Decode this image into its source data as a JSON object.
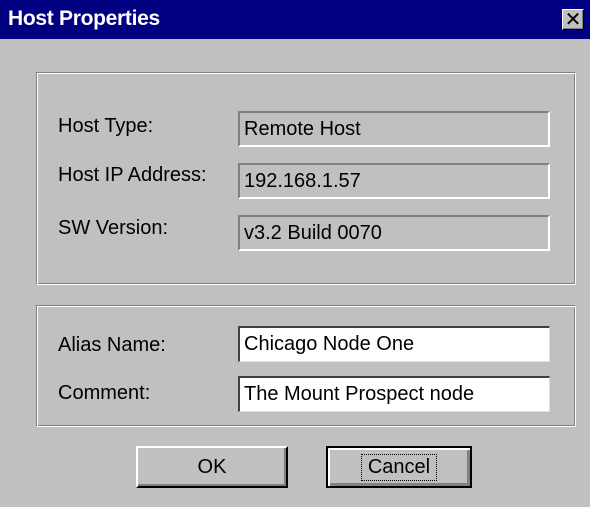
{
  "window": {
    "title": "Host Properties",
    "close_glyph": "✕"
  },
  "info": {
    "host_type_label": "Host Type:",
    "host_type_value": "Remote  Host",
    "host_ip_label": "Host IP Address:",
    "host_ip_value": "192.168.1.57",
    "sw_version_label": "SW Version:",
    "sw_version_value": "v3.2  Build 0070"
  },
  "edit": {
    "alias_label": "Alias Name:",
    "alias_value": "Chicago Node One",
    "comment_label": "Comment:",
    "comment_value": "The Mount Prospect node"
  },
  "buttons": {
    "ok_label": "OK",
    "cancel_label": "Cancel"
  },
  "colors": {
    "titlebar": "#000080",
    "face": "#c0c0c0"
  }
}
